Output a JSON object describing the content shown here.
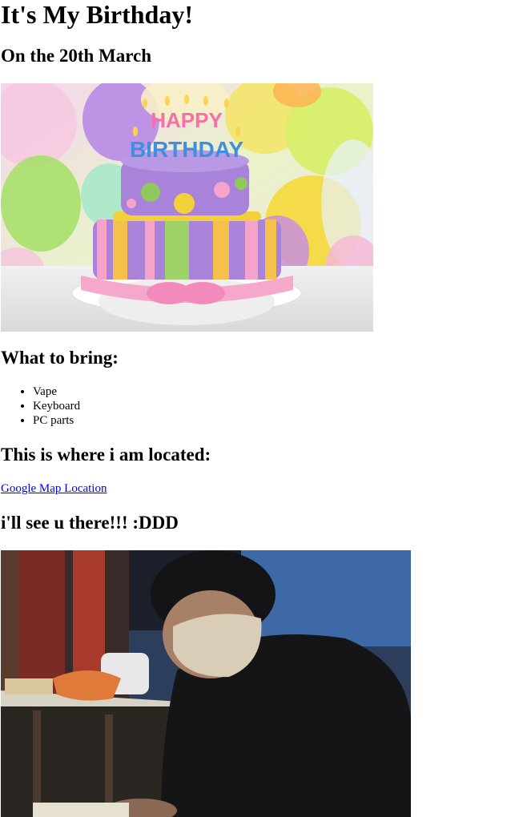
{
  "page": {
    "title": "It's My Birthday!",
    "subtitle": "On the 20th March",
    "bring_heading": "What to bring:",
    "bring_items": [
      "Vape",
      "Keyboard",
      "PC parts"
    ],
    "location_heading": "This is where i am located:",
    "map_link_text": "Google Map Location",
    "see_you": "i'll see u there!!! :DDD"
  },
  "cake_image": {
    "topper_text": "HAPPY BIRTHDAY"
  },
  "colors": {
    "link": "#0000ee",
    "text": "#000000",
    "background": "#ffffff"
  }
}
